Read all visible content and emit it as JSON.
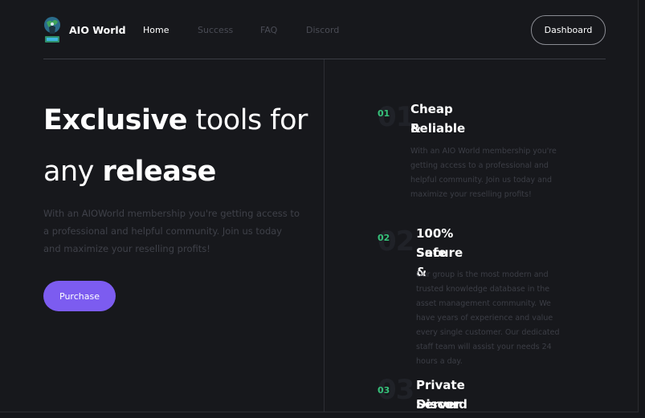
{
  "header": {
    "brand": "AIO World",
    "nav": [
      {
        "label": "Home",
        "active": true
      },
      {
        "label": "Success",
        "active": false
      },
      {
        "label": "FAQ",
        "active": false
      },
      {
        "label": "Discord",
        "active": false
      }
    ],
    "dashboard_label": "Dashboard"
  },
  "hero": {
    "title_part1": "Exclusive",
    "title_part2": "tools for",
    "title_part3": "any",
    "title_part4": "release",
    "description": "With an AIOWorld membership you're getting access to a professional and helpful community. Join us today and maximize your reselling profits!",
    "purchase_label": "Purchase"
  },
  "features": [
    {
      "number": "01",
      "title_line1": "Cheap &",
      "title_line2": "Reliable",
      "description": "With an AIO World membership you're getting access to a professional and helpful community. Join us today and maximize your reselling profits!"
    },
    {
      "number": "02",
      "title_line1": "100% Secure &",
      "title_line2": "Safe",
      "description": "Our group is the most modern and trusted knowledge database in the asset management community. We have years of experience and value every single customer. Our dedicated staff team will assist your needs 24 hours a day."
    },
    {
      "number": "03",
      "title_line1": "Private Discord",
      "title_line2": "Server",
      "description": ""
    }
  ],
  "colors": {
    "background": "#17181c",
    "accent_purple": "#7c5cf0",
    "accent_green": "#36c27a",
    "muted_text": "#3f4149"
  },
  "icons": {
    "logo": "globe-logo-icon"
  }
}
